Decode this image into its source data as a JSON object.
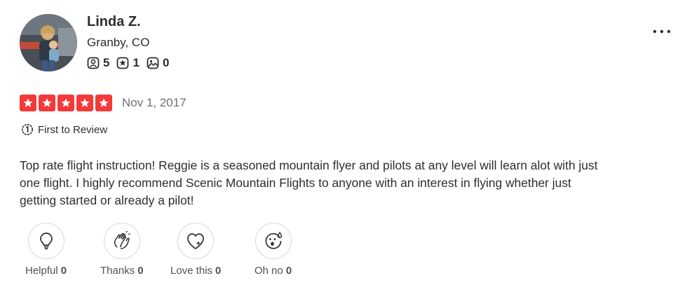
{
  "user": {
    "name": "Linda Z.",
    "location": "Granby, CO",
    "stats": [
      {
        "icon": "friends-icon",
        "value": "5"
      },
      {
        "icon": "review-star-icon",
        "value": "1"
      },
      {
        "icon": "photo-icon",
        "value": "0"
      }
    ]
  },
  "review": {
    "rating": 5,
    "rating_color": "#f43939",
    "date": "Nov 1, 2017",
    "badge": "First to Review",
    "text": "Top rate flight instruction! Reggie is a seasoned mountain flyer and pilots at any level will learn alot with just one flight. I highly recommend Scenic Mountain Flights to anyone with an interest in flying whether just getting started or already a pilot!"
  },
  "reactions": [
    {
      "icon": "lightbulb-icon",
      "label": "Helpful",
      "count": "0"
    },
    {
      "icon": "clapping-hands-icon",
      "label": "Thanks",
      "count": "0"
    },
    {
      "icon": "heart-icon",
      "label": "Love this",
      "count": "0"
    },
    {
      "icon": "surprised-face-icon",
      "label": "Oh no",
      "count": "0"
    }
  ]
}
